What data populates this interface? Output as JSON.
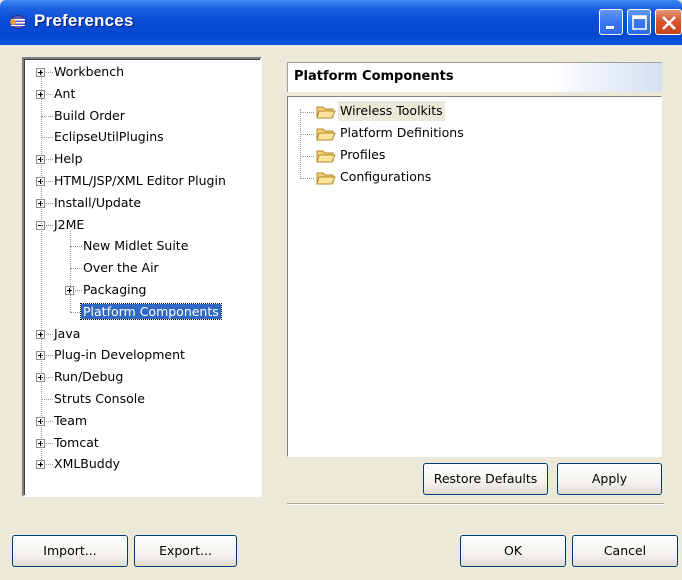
{
  "window": {
    "title": "Preferences",
    "controls": {
      "minimize": "minimize-icon",
      "maximize": "maximize-icon",
      "close": "close-icon"
    }
  },
  "tree": {
    "items": [
      {
        "label": "Workbench",
        "level": 0,
        "expander": "plus"
      },
      {
        "label": "Ant",
        "level": 0,
        "expander": "plus"
      },
      {
        "label": "Build Order",
        "level": 0,
        "expander": "none"
      },
      {
        "label": "EclipseUtilPlugins",
        "level": 0,
        "expander": "none"
      },
      {
        "label": "Help",
        "level": 0,
        "expander": "plus"
      },
      {
        "label": "HTML/JSP/XML Editor Plugin",
        "level": 0,
        "expander": "plus"
      },
      {
        "label": "Install/Update",
        "level": 0,
        "expander": "plus"
      },
      {
        "label": "J2ME",
        "level": 0,
        "expander": "minus"
      },
      {
        "label": "New Midlet Suite",
        "level": 1,
        "expander": "none"
      },
      {
        "label": "Over the Air",
        "level": 1,
        "expander": "none"
      },
      {
        "label": "Packaging",
        "level": 1,
        "expander": "plus"
      },
      {
        "label": "Platform Components",
        "level": 1,
        "expander": "none",
        "selected": true
      },
      {
        "label": "Java",
        "level": 0,
        "expander": "plus"
      },
      {
        "label": "Plug-in Development",
        "level": 0,
        "expander": "plus"
      },
      {
        "label": "Run/Debug",
        "level": 0,
        "expander": "plus"
      },
      {
        "label": "Struts Console",
        "level": 0,
        "expander": "none"
      },
      {
        "label": "Team",
        "level": 0,
        "expander": "plus"
      },
      {
        "label": "Tomcat",
        "level": 0,
        "expander": "plus"
      },
      {
        "label": "XMLBuddy",
        "level": 0,
        "expander": "plus"
      }
    ]
  },
  "page": {
    "title": "Platform Components",
    "components": [
      {
        "label": "Wireless Toolkits",
        "icon": "folder-open-icon",
        "highlighted": true
      },
      {
        "label": "Platform Definitions",
        "icon": "folder-open-icon"
      },
      {
        "label": "Profiles",
        "icon": "folder-open-icon"
      },
      {
        "label": "Configurations",
        "icon": "folder-open-icon"
      }
    ],
    "restore_defaults_label": "Restore Defaults",
    "apply_label": "Apply"
  },
  "footer": {
    "import_label": "Import...",
    "export_label": "Export...",
    "ok_label": "OK",
    "cancel_label": "Cancel"
  },
  "colors": {
    "titlebar": "#0548d0",
    "dialog_bg": "#ece9d8",
    "selection": "#316ac5",
    "folder": "#f4d06f"
  }
}
